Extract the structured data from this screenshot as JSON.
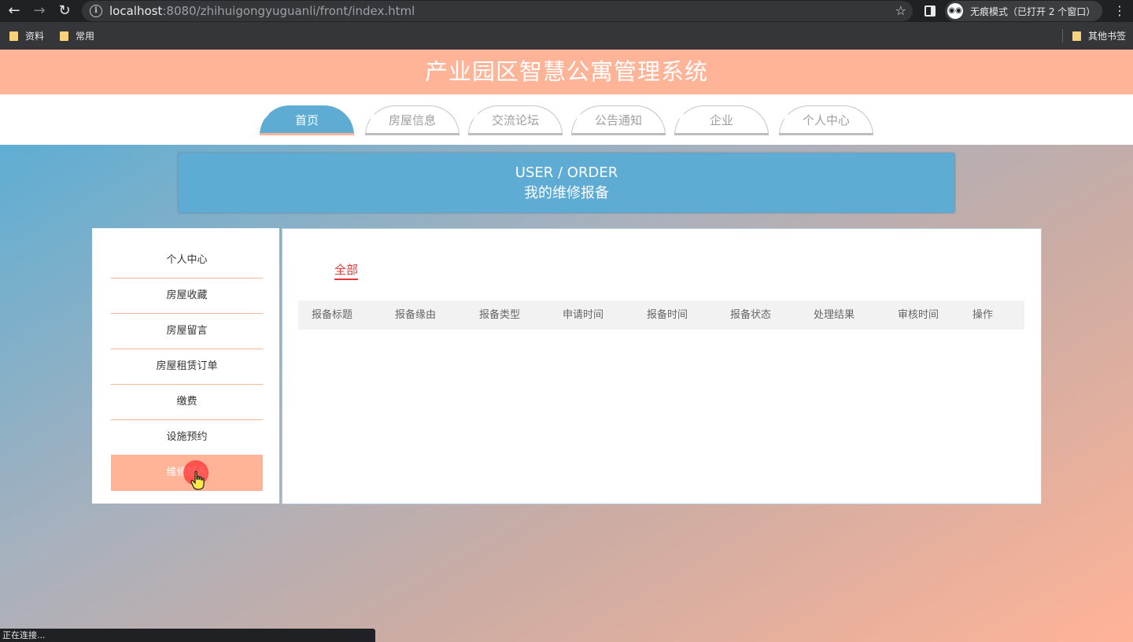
{
  "browser": {
    "url_host": "localhost",
    "url_path": ":8080/zhihuigongyuguanli/front/index.html",
    "incognito_label": "无痕模式（已打开 2 个窗口）",
    "bookmarks": [
      "资料",
      "常用"
    ],
    "other_bookmarks": "其他书签",
    "status_text": "正在连接..."
  },
  "site": {
    "title": "产业园区智慧公寓管理系统",
    "nav": [
      "首页",
      "房屋信息",
      "交流论坛",
      "公告通知",
      "企业",
      "个人中心"
    ],
    "active_nav": 0
  },
  "banner": {
    "en": "USER / ORDER",
    "cn": "我的维修报备"
  },
  "sidebar": {
    "items": [
      "个人中心",
      "房屋收藏",
      "房屋留言",
      "房屋租赁订单",
      "缴费",
      "设施预约",
      "维修报备"
    ],
    "active": 6
  },
  "filter": {
    "tabs": [
      "全部"
    ]
  },
  "table": {
    "columns": [
      "报备标题",
      "报备缘由",
      "报备类型",
      "申请时间",
      "报备时间",
      "报备状态",
      "处理结果",
      "审核时间",
      "操作"
    ],
    "rows": []
  },
  "colors": {
    "header": "#ffb397",
    "accent_blue": "#5eabd4",
    "active_tab_text": "#e03a3a"
  }
}
